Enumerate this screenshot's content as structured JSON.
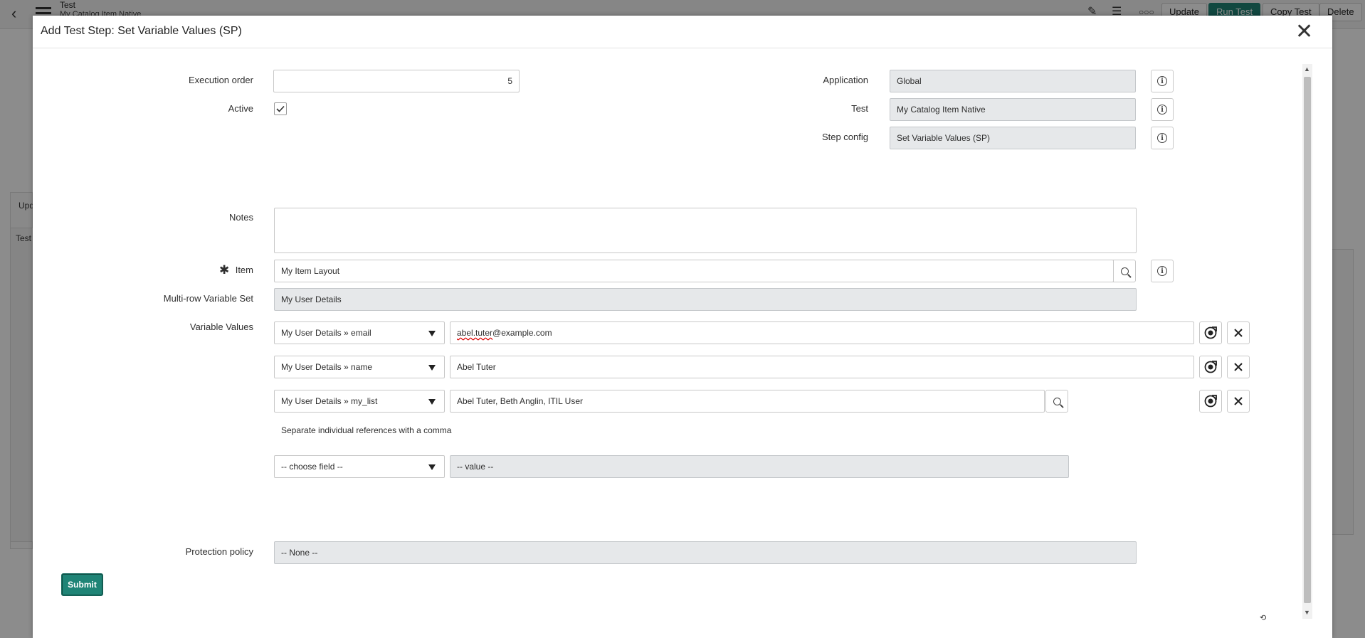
{
  "background_app": {
    "title": "Test",
    "subtitle": "My Catalog Item Native",
    "buttons": {
      "update": "Update",
      "run_test": "Run Test",
      "copy_test": "Copy Test",
      "delete": "Delete"
    },
    "left_fragments": {
      "upd": "Upd",
      "test": "Test"
    }
  },
  "modal": {
    "title": "Add Test Step: Set Variable Values (SP)",
    "close_icon": "close-icon"
  },
  "form": {
    "execution_order": {
      "label": "Execution order",
      "value": "5"
    },
    "active": {
      "label": "Active",
      "checked": true
    },
    "application": {
      "label": "Application",
      "value": "Global"
    },
    "test": {
      "label": "Test",
      "value": "My Catalog Item Native"
    },
    "step_config": {
      "label": "Step config",
      "value": "Set Variable Values (SP)"
    },
    "notes": {
      "label": "Notes",
      "value": ""
    },
    "item": {
      "label": "Item",
      "value": "My Item Layout"
    },
    "mrvs": {
      "label": "Multi-row Variable Set",
      "value": "My User Details"
    },
    "variable_values": {
      "label": "Variable Values",
      "rows": [
        {
          "field": "My User Details » email",
          "value_prefix": "abel.tuter",
          "value_suffix": "@example.com"
        },
        {
          "field": "My User Details » name",
          "value": "Abel Tuter"
        },
        {
          "field": "My User Details » my_list",
          "value": "Abel Tuter, Beth Anglin, ITIL User"
        }
      ],
      "help_text": "Separate individual references with a comma",
      "new_row": {
        "field_placeholder": "-- choose field --",
        "value_placeholder": "-- value --"
      }
    },
    "protection_policy": {
      "label": "Protection policy",
      "value": "-- None --"
    }
  },
  "submit_label": "Submit",
  "colors": {
    "accent": "#1f8476",
    "readonly_bg": "#e6e8ea",
    "border": "#c8c8c8"
  }
}
